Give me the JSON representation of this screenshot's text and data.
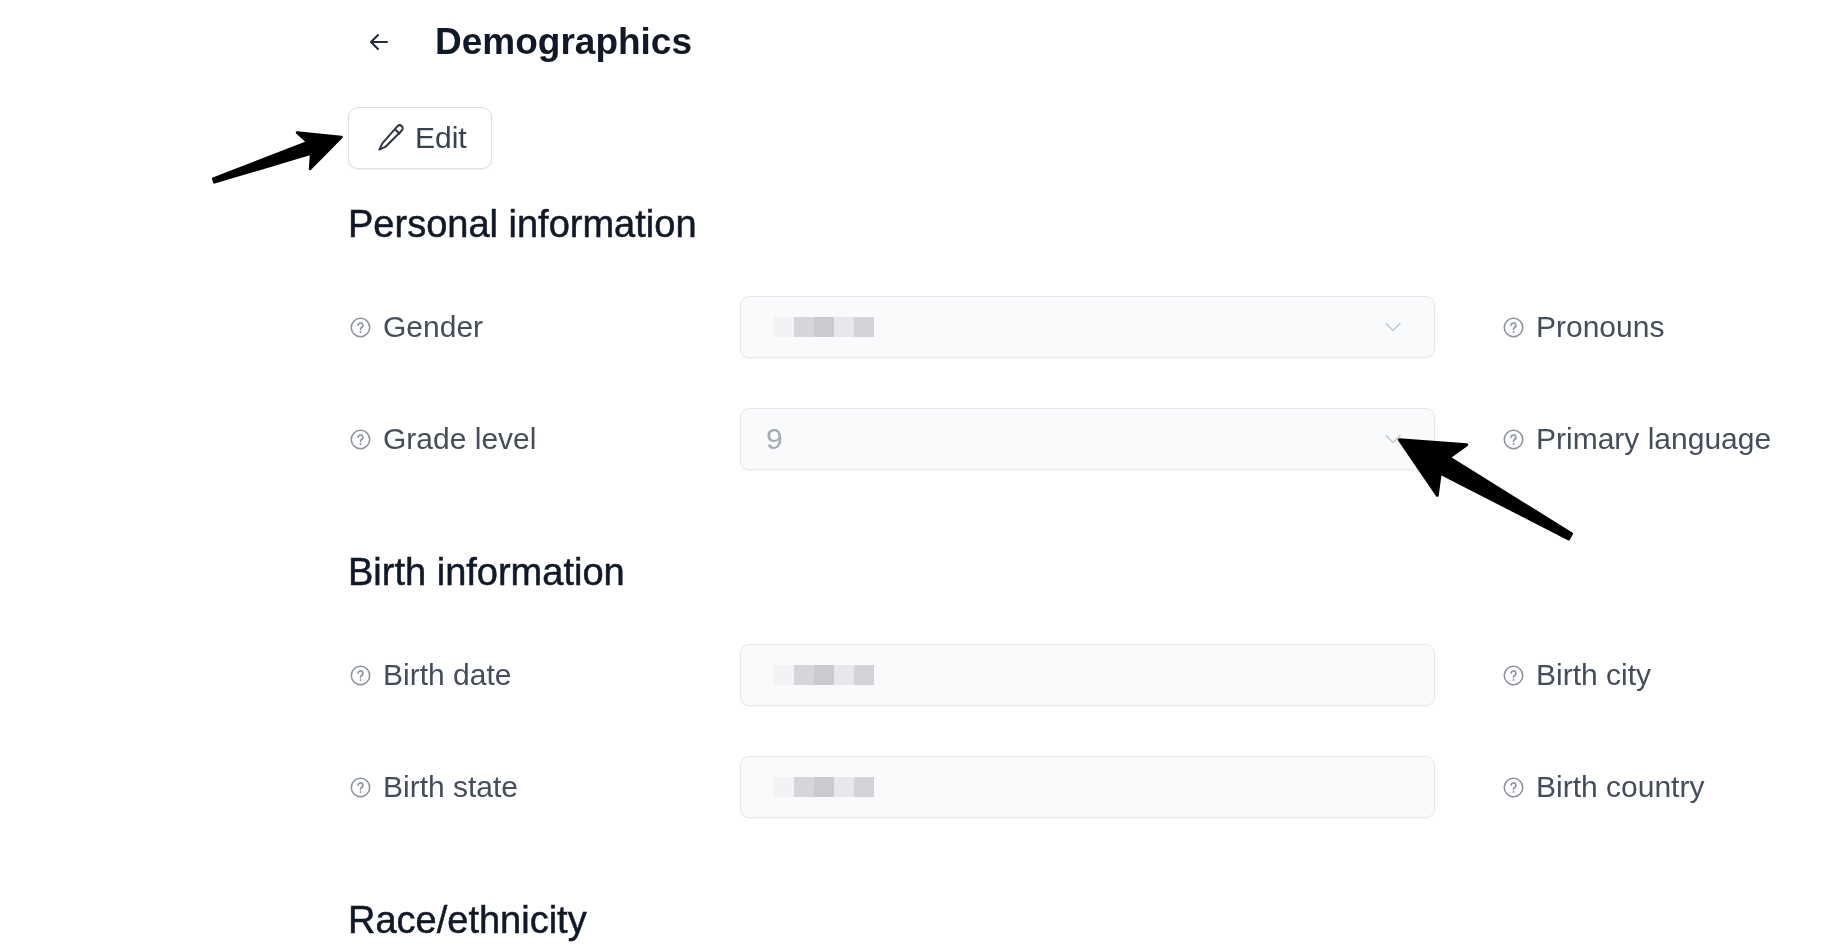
{
  "header": {
    "title": "Demographics"
  },
  "edit_button": {
    "label": "Edit"
  },
  "sections": [
    {
      "title": "Personal information",
      "rows": [
        {
          "left": {
            "label": "Gender",
            "kind": "select",
            "disabled": true,
            "redacted": true
          },
          "right": {
            "label": "Pronouns"
          }
        },
        {
          "left": {
            "label": "Grade level",
            "kind": "select",
            "disabled": true,
            "redacted": false,
            "value": "9"
          },
          "right": {
            "label": "Primary language"
          }
        }
      ]
    },
    {
      "title": "Birth information",
      "rows": [
        {
          "left": {
            "label": "Birth date",
            "kind": "text",
            "disabled": true,
            "redacted": true
          },
          "right": {
            "label": "Birth city"
          }
        },
        {
          "left": {
            "label": "Birth state",
            "kind": "text",
            "disabled": true,
            "redacted": true
          },
          "right": {
            "label": "Birth country"
          }
        }
      ]
    },
    {
      "title": "Race/ethnicity"
    }
  ]
}
